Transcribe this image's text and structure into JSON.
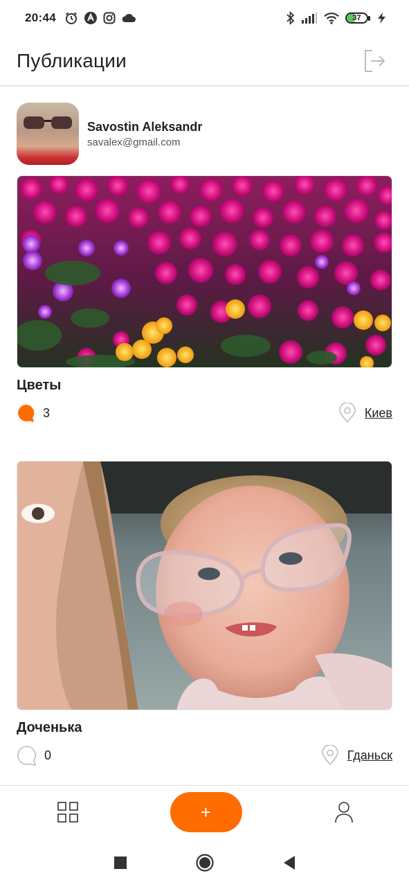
{
  "status_bar": {
    "time": "20:44",
    "battery_level": "37",
    "icons": [
      "alarm-icon",
      "app-a-icon",
      "instagram-icon",
      "cloud-icon",
      "bluetooth-icon",
      "signal-icon",
      "wifi-icon",
      "battery-icon",
      "charging-icon"
    ]
  },
  "header": {
    "title": "Публикации",
    "logout_icon": "logout-icon"
  },
  "profile": {
    "name": "Savostin Aleksandr",
    "email": "savalex@gmail.com"
  },
  "posts": [
    {
      "title": "Цветы",
      "comment_count": "3",
      "location": "Киев",
      "has_comments": true,
      "image": "flower-field-photo"
    },
    {
      "title": "Доченька",
      "comment_count": "0",
      "location": "Гданьск",
      "has_comments": false,
      "image": "child-with-glasses-photo"
    }
  ],
  "bottom_nav": {
    "grid_icon": "grid-icon",
    "create_label": "+",
    "profile_icon": "user-icon"
  },
  "colors": {
    "accent": "#ff6c00",
    "text": "#212121",
    "divider": "#e0e0e0"
  }
}
